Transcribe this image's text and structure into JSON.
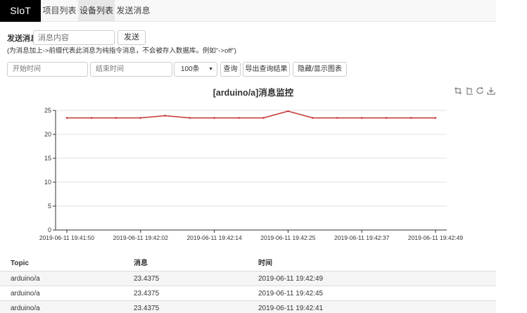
{
  "navbar": {
    "brand": "SIoT",
    "items": [
      {
        "label": "项目列表",
        "active": false
      },
      {
        "label": "设备列表",
        "active": true
      },
      {
        "label": "发送消息",
        "active": false
      }
    ]
  },
  "send": {
    "label": "发送消息",
    "placeholder": "消息内容",
    "button": "发送",
    "hint": "(为消息加上->前缀代表此消息为纯指令消息，不会被存入数据库。例如\"->off\")"
  },
  "filter": {
    "start_placeholder": "开始时间",
    "end_placeholder": "结束时间",
    "limit_value": "100条",
    "query_button": "查询",
    "export_button": "导出查询结果",
    "toggle_chart_button": "隐藏/显示图表"
  },
  "toolbox": [
    "zoom-icon",
    "zoom-reset-icon",
    "restore-icon",
    "save-image-icon"
  ],
  "chart_data": {
    "type": "line",
    "title": "[arduino/a]消息监控",
    "x": [
      "2019-06-11 19:41:50",
      "2019-06-11 19:41:54",
      "2019-06-11 19:41:58",
      "2019-06-11 19:42:02",
      "2019-06-11 19:42:06",
      "2019-06-11 19:42:10",
      "2019-06-11 19:42:14",
      "2019-06-11 19:42:17",
      "2019-06-11 19:42:21",
      "2019-06-11 19:42:25",
      "2019-06-11 19:42:29",
      "2019-06-11 19:42:33",
      "2019-06-11 19:42:37",
      "2019-06-11 19:42:41",
      "2019-06-11 19:42:45",
      "2019-06-11 19:42:49"
    ],
    "series": [
      {
        "values": [
          23.4375,
          23.4375,
          23.4375,
          23.4375,
          23.9,
          23.4375,
          23.4375,
          23.4375,
          23.4375,
          24.85,
          23.4375,
          23.4375,
          23.4375,
          23.4375,
          23.4375,
          23.4375
        ],
        "color": "#c23531"
      }
    ],
    "xticks": [
      "2019-06-11 19:41:50",
      "2019-06-11 19:42:02",
      "2019-06-11 19:42:14",
      "2019-06-11 19:42:25",
      "2019-06-11 19:42:37",
      "2019-06-11 19:42:49"
    ],
    "yticks": [
      0,
      5,
      10,
      15,
      20,
      25
    ],
    "ylim": [
      0,
      25
    ],
    "grid": true
  },
  "table": {
    "headers": [
      "Topic",
      "消息",
      "时间"
    ],
    "rows": [
      [
        "arduino/a",
        "23.4375",
        "2019-06-11 19:42:49"
      ],
      [
        "arduino/a",
        "23.4375",
        "2019-06-11 19:42:45"
      ],
      [
        "arduino/a",
        "23.4375",
        "2019-06-11 19:42:41"
      ]
    ]
  }
}
